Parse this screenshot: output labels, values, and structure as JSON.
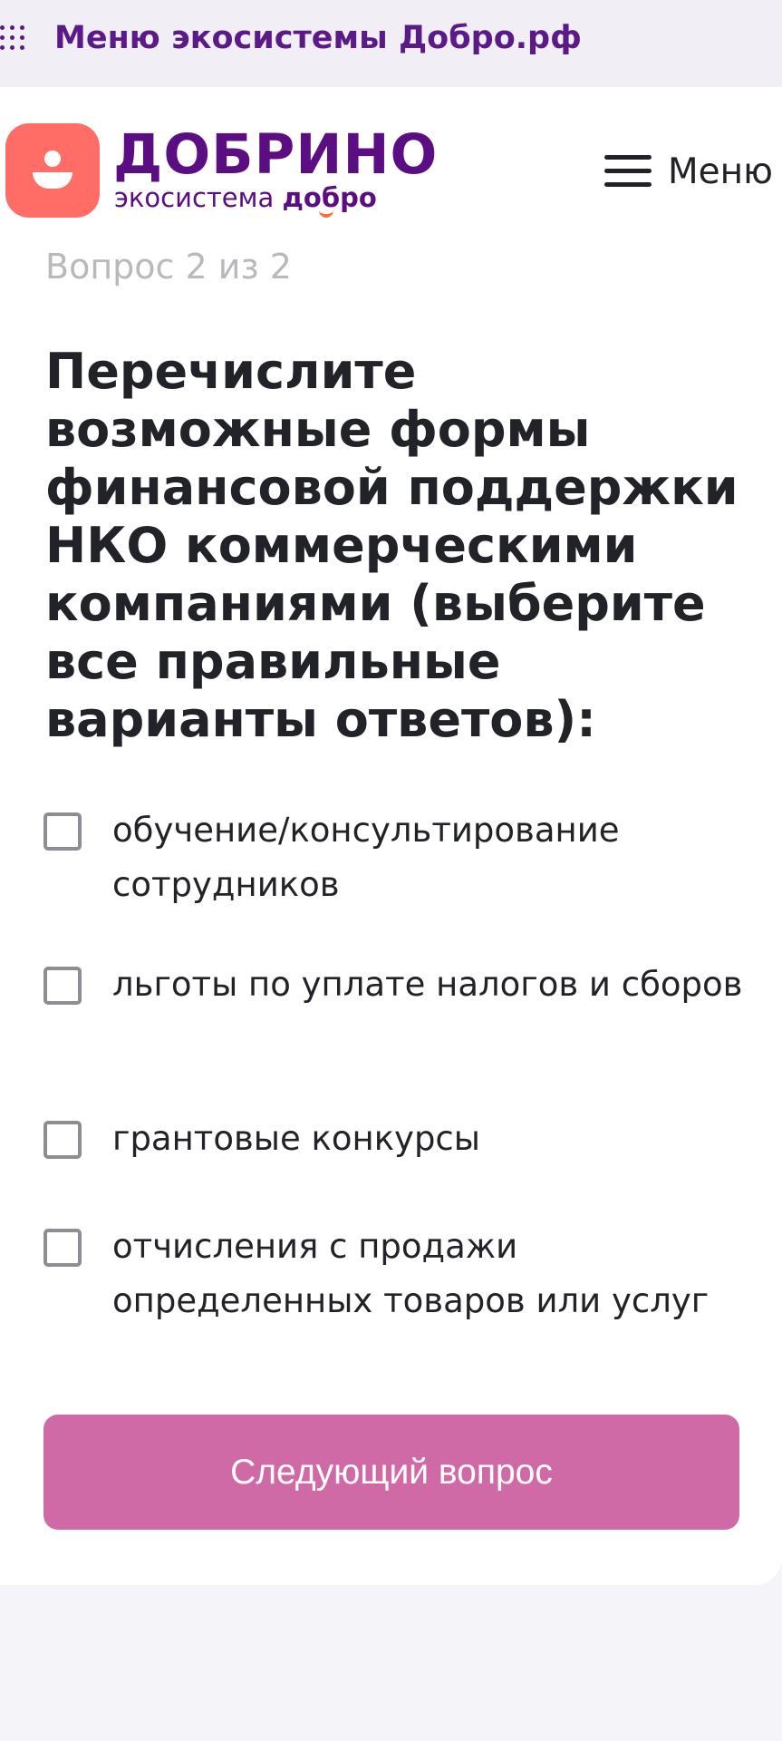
{
  "ecosystem_bar": {
    "icon": "grid-dots-icon",
    "label": "Меню экосистемы Добро.рф"
  },
  "header": {
    "logo_icon": "person-icon",
    "logo_title": "ДОБРИНО",
    "logo_subtitle_prefix": "экосистема",
    "logo_subtitle_brand": "добро",
    "menu_icon": "hamburger-icon",
    "menu_label": "Меню"
  },
  "quiz": {
    "progress": "Вопрос 2 из 2",
    "question": "Перечислите возможные формы финансовой поддержки НКО коммерческими компаниями (выберите все правильные варианты ответов):",
    "options": [
      {
        "label": "обучение/консультирование сотрудников",
        "checked": false
      },
      {
        "label": "льготы по уплате налогов и сборов",
        "checked": false
      },
      {
        "label": "грантовые конкурсы",
        "checked": false
      },
      {
        "label": "отчисления с продажи определенных товаров или услуг",
        "checked": false
      }
    ],
    "next_button": "Следующий вопрос"
  },
  "colors": {
    "brand_purple": "#5b0d82",
    "logo_coral": "#ff6d66",
    "button_pink": "#d06aa6",
    "ecosystem_bar_bg": "#f2eef5"
  }
}
